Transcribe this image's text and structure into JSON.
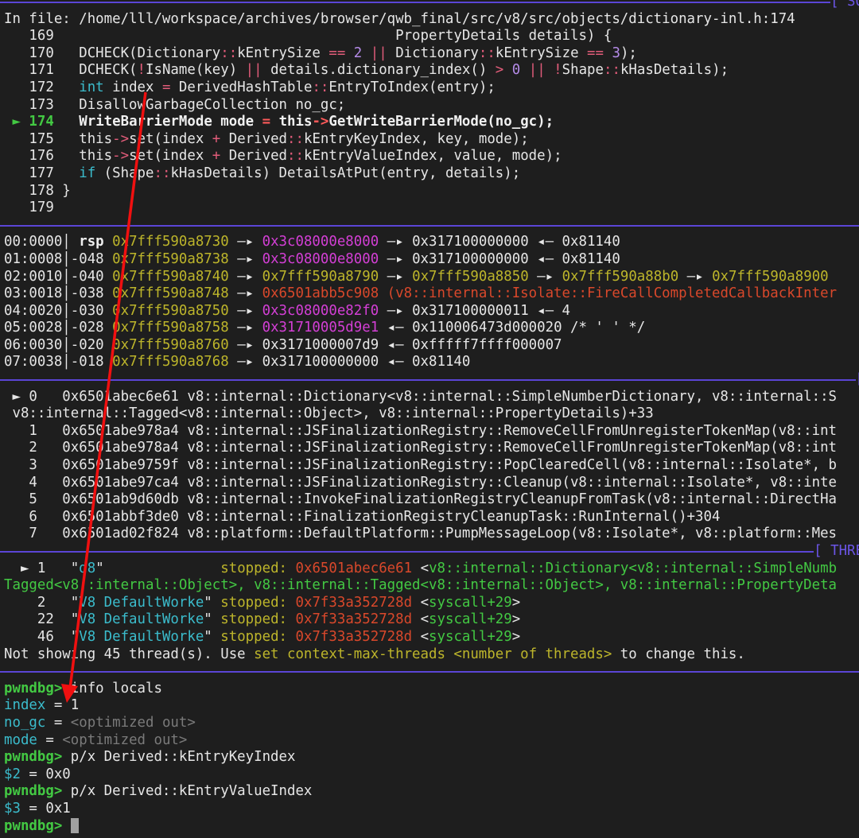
{
  "colors": {
    "separator": "#5b45d6",
    "annotation_arrow": "#f01010",
    "background": "#1e1e1e"
  },
  "rows": [
    {
      "sep": "[ SO"
    },
    {
      "segs": [
        [
          "In file: /home/lll/workspace/archives/browser/qwb_final/src/v8/src/objects/dictionary-inl.h:174",
          "w"
        ]
      ]
    },
    {
      "segs": [
        [
          "   169",
          "w"
        ],
        [
          "                                         PropertyDetails details) {",
          "w"
        ]
      ]
    },
    {
      "segs": [
        [
          "   170   ",
          "w"
        ],
        [
          "DCHECK(Dictionary",
          "w"
        ],
        [
          "::",
          "p"
        ],
        [
          "kEntrySize ",
          "w"
        ],
        [
          "==",
          "p"
        ],
        [
          " ",
          "w"
        ],
        [
          "2",
          "v"
        ],
        [
          " ",
          "w"
        ],
        [
          "||",
          "p"
        ],
        [
          " Dictionary",
          "w"
        ],
        [
          "::",
          "p"
        ],
        [
          "kEntrySize ",
          "w"
        ],
        [
          "==",
          "p"
        ],
        [
          " ",
          "w"
        ],
        [
          "3",
          "v"
        ],
        [
          ");",
          "w"
        ]
      ]
    },
    {
      "segs": [
        [
          "   171   ",
          "w"
        ],
        [
          "DCHECK(",
          "w"
        ],
        [
          "!",
          "p"
        ],
        [
          "IsName(key) ",
          "w"
        ],
        [
          "||",
          "p"
        ],
        [
          " details.dictionary_index() ",
          "w"
        ],
        [
          ">",
          "p"
        ],
        [
          " ",
          "w"
        ],
        [
          "0",
          "v"
        ],
        [
          " ",
          "w"
        ],
        [
          "||",
          "p"
        ],
        [
          " ",
          "w"
        ],
        [
          "!",
          "p"
        ],
        [
          "Shape",
          "w"
        ],
        [
          "::",
          "p"
        ],
        [
          "kHasDetails);",
          "w"
        ]
      ]
    },
    {
      "segs": [
        [
          "   172   ",
          "w"
        ],
        [
          "int",
          "c"
        ],
        [
          " index ",
          "w"
        ],
        [
          "=",
          "p"
        ],
        [
          " DerivedHashTable",
          "w"
        ],
        [
          "::",
          "p"
        ],
        [
          "EntryToIndex(entry);",
          "w"
        ]
      ]
    },
    {
      "segs": [
        [
          "   173   ",
          "w"
        ],
        [
          "DisallowGarbageCollection no_gc;",
          "w"
        ]
      ]
    },
    {
      "segs": [
        [
          " ► ",
          "g"
        ],
        [
          "174",
          "gb"
        ],
        [
          "   ",
          "w"
        ],
        [
          "WriteBarrierMode mode ",
          "b"
        ],
        [
          "=",
          "pb"
        ],
        [
          " this",
          "b"
        ],
        [
          "->",
          "pb"
        ],
        [
          "GetWriteBarrierMode(no_gc);",
          "b"
        ]
      ]
    },
    {
      "segs": [
        [
          "   175   ",
          "w"
        ],
        [
          "this",
          "w"
        ],
        [
          "->",
          "p"
        ],
        [
          "set(index ",
          "w"
        ],
        [
          "+",
          "p"
        ],
        [
          " Derived",
          "w"
        ],
        [
          "::",
          "p"
        ],
        [
          "kEntryKeyIndex, key, mode);",
          "w"
        ]
      ]
    },
    {
      "segs": [
        [
          "   176   ",
          "w"
        ],
        [
          "this",
          "w"
        ],
        [
          "->",
          "p"
        ],
        [
          "set(index ",
          "w"
        ],
        [
          "+",
          "p"
        ],
        [
          " Derived",
          "w"
        ],
        [
          "::",
          "p"
        ],
        [
          "kEntryValueIndex, value, mode);",
          "w"
        ]
      ]
    },
    {
      "segs": [
        [
          "   177   ",
          "w"
        ],
        [
          "if",
          "c"
        ],
        [
          " (Shape",
          "w"
        ],
        [
          "::",
          "p"
        ],
        [
          "kHasDetails) DetailsAtPut(entry, details);",
          "w"
        ]
      ]
    },
    {
      "segs": [
        [
          "   178 }",
          "w"
        ]
      ]
    },
    {
      "segs": [
        [
          "   179",
          "w"
        ]
      ]
    },
    {
      "sep": ""
    },
    {
      "segs": [
        [
          "00:0000│ ",
          "w"
        ],
        [
          "rsp ",
          "b"
        ],
        [
          "0x7fff590a8730",
          "y"
        ],
        [
          " —▸ ",
          "w"
        ],
        [
          "0x3c08000e8000",
          "m"
        ],
        [
          " —▸ 0x317100000000 ◂— 0x81140",
          "w"
        ]
      ]
    },
    {
      "segs": [
        [
          "01:0008│-048 ",
          "w"
        ],
        [
          "0x7fff590a8738",
          "y"
        ],
        [
          " —▸ ",
          "w"
        ],
        [
          "0x3c08000e8000",
          "m"
        ],
        [
          " —▸ 0x317100000000 ◂— 0x81140",
          "w"
        ]
      ]
    },
    {
      "segs": [
        [
          "02:0010│-040 ",
          "w"
        ],
        [
          "0x7fff590a8740",
          "y"
        ],
        [
          " —▸ ",
          "w"
        ],
        [
          "0x7fff590a8790",
          "y"
        ],
        [
          " —▸ ",
          "w"
        ],
        [
          "0x7fff590a8850",
          "y"
        ],
        [
          " —▸ ",
          "w"
        ],
        [
          "0x7fff590a88b0",
          "y"
        ],
        [
          " —▸ ",
          "w"
        ],
        [
          "0x7fff590a8900",
          "y"
        ]
      ]
    },
    {
      "segs": [
        [
          "03:0018│-038 ",
          "w"
        ],
        [
          "0x7fff590a8748",
          "y"
        ],
        [
          " —▸ ",
          "w"
        ],
        [
          "0x6501abb5c908 (v8::internal::Isolate::FireCallCompletedCallbackInter",
          "r"
        ]
      ]
    },
    {
      "segs": [
        [
          "04:0020│-030 ",
          "w"
        ],
        [
          "0x7fff590a8750",
          "y"
        ],
        [
          " —▸ ",
          "w"
        ],
        [
          "0x3c08000e82f0",
          "m"
        ],
        [
          " —▸ 0x317100000011 ◂— 4",
          "w"
        ]
      ]
    },
    {
      "segs": [
        [
          "05:0028│-028 ",
          "w"
        ],
        [
          "0x7fff590a8758",
          "y"
        ],
        [
          " —▸ ",
          "w"
        ],
        [
          "0x31710005d9e1",
          "m"
        ],
        [
          " ◂— 0x110006473d000020 /* ' ' */",
          "w"
        ]
      ]
    },
    {
      "segs": [
        [
          "06:0030│-020 ",
          "w"
        ],
        [
          "0x7fff590a8760",
          "y"
        ],
        [
          " —▸ 0x3171000007d9 ◂— 0xfffff7ffff000007",
          "w"
        ]
      ]
    },
    {
      "segs": [
        [
          "07:0038│-018 ",
          "w"
        ],
        [
          "0x7fff590a8768",
          "y"
        ],
        [
          " —▸ 0x317100000000 ◂— 0x81140",
          "w"
        ]
      ]
    },
    {
      "sep": "["
    },
    {
      "segs": [
        [
          " ► ",
          "w"
        ],
        [
          "0   0x6501abec6e61 v8::internal::Dictionary<v8::internal::SimpleNumberDictionary, v8::internal::S",
          "w"
        ]
      ]
    },
    {
      "segs": [
        [
          " v8::internal::Tagged<v8::internal::Object>, v8::internal::PropertyDetails)+33",
          "w"
        ]
      ]
    },
    {
      "segs": [
        [
          "   1   0x6501abe978a4 v8::internal::JSFinalizationRegistry::RemoveCellFromUnregisterTokenMap(v8::int",
          "w"
        ]
      ]
    },
    {
      "segs": [
        [
          "   2   0x6501abe978a4 v8::internal::JSFinalizationRegistry::RemoveCellFromUnregisterTokenMap(v8::int",
          "w"
        ]
      ]
    },
    {
      "segs": [
        [
          "   3   0x6501abe9759f v8::internal::JSFinalizationRegistry::PopClearedCell(v8::internal::Isolate*, b",
          "w"
        ]
      ]
    },
    {
      "segs": [
        [
          "   4   0x6501abe97ca4 v8::internal::JSFinalizationRegistry::Cleanup(v8::internal::Isolate*, v8::inte",
          "w"
        ]
      ]
    },
    {
      "segs": [
        [
          "   5   0x6501ab9d60db v8::internal::InvokeFinalizationRegistryCleanupFromTask(v8::internal::DirectHa",
          "w"
        ]
      ]
    },
    {
      "segs": [
        [
          "   6   0x6501abbf3de0 v8::internal::FinalizationRegistryCleanupTask::RunInternal()+304",
          "w"
        ]
      ]
    },
    {
      "segs": [
        [
          "   7   0x6501ad02f824 v8::platform::DefaultPlatform::PumpMessageLoop(v8::Isolate*, v8::platform::Mes",
          "w"
        ]
      ]
    },
    {
      "sep": "[ THRE"
    },
    {
      "segs": [
        [
          "  ► ",
          "w"
        ],
        [
          "1   \"",
          "w"
        ],
        [
          "d8",
          "c"
        ],
        [
          "\"              ",
          "w"
        ],
        [
          "stopped:",
          "y"
        ],
        [
          " ",
          "w"
        ],
        [
          "0x6501abec6e61",
          "r"
        ],
        [
          " <",
          "w"
        ],
        [
          "v8::internal::Dictionary<v8::internal::SimpleNumb",
          "g"
        ]
      ]
    },
    {
      "segs": [
        [
          "Tagged<v8::internal::Object>, v8::internal::Tagged<v8::internal::Object>, v8::internal::PropertyDeta",
          "g"
        ]
      ]
    },
    {
      "segs": [
        [
          "    2   \"",
          "w"
        ],
        [
          "V8 DefaultWorke",
          "c"
        ],
        [
          "\" ",
          "w"
        ],
        [
          "stopped:",
          "y"
        ],
        [
          " ",
          "w"
        ],
        [
          "0x7f33a352728d",
          "r"
        ],
        [
          " <",
          "w"
        ],
        [
          "syscall+29",
          "g"
        ],
        [
          ">",
          "w"
        ]
      ]
    },
    {
      "segs": [
        [
          "    22  \"",
          "w"
        ],
        [
          "V8 DefaultWorke",
          "c"
        ],
        [
          "\" ",
          "w"
        ],
        [
          "stopped:",
          "y"
        ],
        [
          " ",
          "w"
        ],
        [
          "0x7f33a352728d",
          "r"
        ],
        [
          " <",
          "w"
        ],
        [
          "syscall+29",
          "g"
        ],
        [
          ">",
          "w"
        ]
      ]
    },
    {
      "segs": [
        [
          "    46  \"",
          "w"
        ],
        [
          "V8 DefaultWorke",
          "c"
        ],
        [
          "\" ",
          "w"
        ],
        [
          "stopped:",
          "y"
        ],
        [
          " ",
          "w"
        ],
        [
          "0x7f33a352728d",
          "r"
        ],
        [
          " <",
          "w"
        ],
        [
          "syscall+29",
          "g"
        ],
        [
          ">",
          "w"
        ]
      ]
    },
    {
      "segs": [
        [
          "Not showing 45 thread(s). Use ",
          "w"
        ],
        [
          "set context-max-threads <number of threads>",
          "y"
        ],
        [
          " to change this.",
          "w"
        ]
      ]
    },
    {
      "sep": ""
    },
    {
      "segs": [
        [
          "pwndbg>",
          "gb"
        ],
        [
          " info locals",
          "w"
        ]
      ]
    },
    {
      "segs": [
        [
          "index",
          "c"
        ],
        [
          " = 1",
          "w"
        ]
      ]
    },
    {
      "segs": [
        [
          "no_gc",
          "c"
        ],
        [
          " = ",
          "w"
        ],
        [
          "<optimized out>",
          "d"
        ]
      ]
    },
    {
      "segs": [
        [
          "mode",
          "c"
        ],
        [
          " = ",
          "w"
        ],
        [
          "<optimized out>",
          "d"
        ]
      ]
    },
    {
      "segs": [
        [
          "pwndbg>",
          "gb"
        ],
        [
          " p/x Derived::kEntryKeyIndex",
          "w"
        ]
      ]
    },
    {
      "segs": [
        [
          "$2",
          "c"
        ],
        [
          " = 0x0",
          "w"
        ]
      ]
    },
    {
      "segs": [
        [
          "pwndbg>",
          "gb"
        ],
        [
          " p/x Derived::kEntryValueIndex",
          "w"
        ]
      ]
    },
    {
      "segs": [
        [
          "$3",
          "c"
        ],
        [
          " = 0x1",
          "w"
        ]
      ]
    },
    {
      "segs": [
        [
          "pwndbg>",
          "gb"
        ],
        [
          " ",
          "w"
        ]
      ],
      "cursor": true
    }
  ]
}
